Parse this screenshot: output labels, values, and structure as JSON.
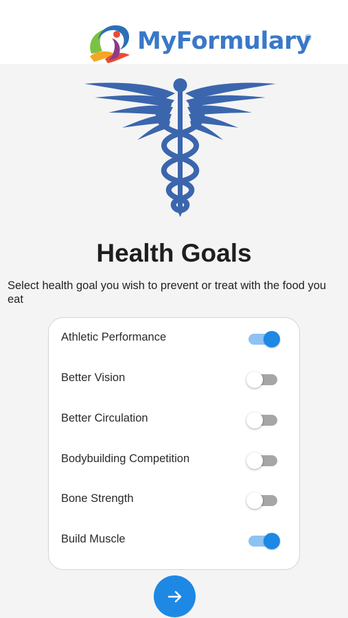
{
  "header": {
    "logo_text": "MyFormulary",
    "logo_reg": "®",
    "logo_icon": "myformulary-logo-icon"
  },
  "hero": {
    "icon": "caduceus-icon",
    "color": "#3b66ad"
  },
  "page": {
    "title": "Health Goals",
    "subtitle": "Select health goal you wish to prevent or treat with the food you eat"
  },
  "goals": [
    {
      "label": "Athletic Performance",
      "enabled": true
    },
    {
      "label": "Better Vision",
      "enabled": false
    },
    {
      "label": "Better Circulation",
      "enabled": false
    },
    {
      "label": "Bodybuilding Competition",
      "enabled": false
    },
    {
      "label": "Bone Strength",
      "enabled": false
    },
    {
      "label": "Build Muscle",
      "enabled": true
    }
  ],
  "next_button": {
    "icon": "arrow-right-icon"
  },
  "colors": {
    "accent": "#1e88e5",
    "toggle_track_on": "#8ec2f3",
    "toggle_track_off": "#a6a6a6",
    "brand_text": "#3a78c7"
  }
}
